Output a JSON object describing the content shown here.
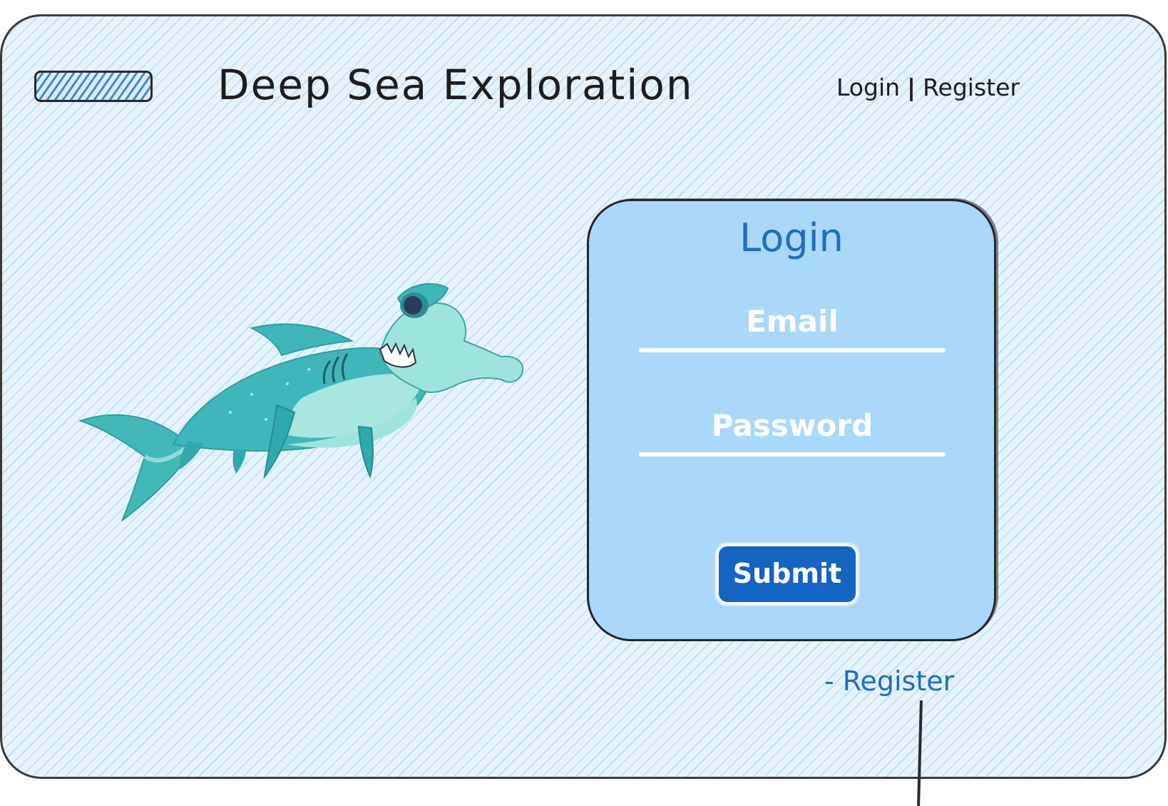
{
  "header": {
    "title": "Deep Sea Exploration",
    "nav": {
      "login": "Login",
      "separator": "|",
      "register": "Register"
    }
  },
  "login_card": {
    "title": "Login",
    "email_placeholder": "Email",
    "password_placeholder": "Password",
    "submit_label": "Submit"
  },
  "register_link": "- Register",
  "colors": {
    "background": "#e6f3fc",
    "hatch": "#96c8ee",
    "card": "#a9d8fb",
    "accent": "#1f6dc2",
    "button": "#1464c2",
    "shark": "#3fb6b9"
  },
  "icons": {
    "logo": "striped-logo-placeholder",
    "illustration": "hammerhead-shark-illustration"
  }
}
